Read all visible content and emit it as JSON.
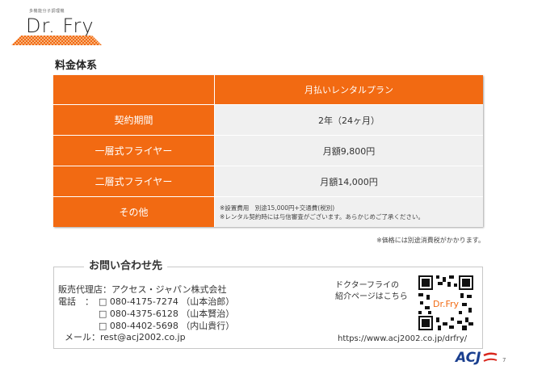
{
  "logo": {
    "small_text": "多機能分子調理機",
    "name": "Dr. Fry",
    "grid_color": "#f26a12"
  },
  "section_title": "料金体系",
  "pricing": {
    "header_plan": "月払いレンタルプラン",
    "rows": [
      {
        "label": "契約期間",
        "value": "2年（24ヶ月）"
      },
      {
        "label": "一層式フライヤー",
        "value": "月額9,800円"
      },
      {
        "label": "二層式フライヤー",
        "value": "月額14,000円"
      }
    ],
    "other_label": "その他",
    "other_notes": [
      "※設置費用　別途15,000円+交通費(税別)",
      "※レンタル契約時には与信審査がございます。あらかじめご了承ください。"
    ],
    "accent_color": "#f26a12"
  },
  "tax_note": "※価格には別途消費税がかかります。",
  "contact": {
    "title": "お問い合わせ先",
    "agency": "販売代理店：アクセス・ジャパン株式会社",
    "phone_label": "電話　：",
    "phones": [
      "□ 080-4175-7274 （山本治郎）",
      "□ 080-4375-6128 （山本賢治）",
      "□ 080-4402-5698 （内山貴行）"
    ],
    "mail": "メール：rest@acj2002.co.jp",
    "qr_caption_1": "ドクターフライの",
    "qr_caption_2": "紹介ページはこちら",
    "qr_inner": "Dr.Fry",
    "url": "https://www.acj2002.co.jp/drfry/"
  },
  "footer": {
    "company_logo": "ACJ",
    "page": "7"
  }
}
